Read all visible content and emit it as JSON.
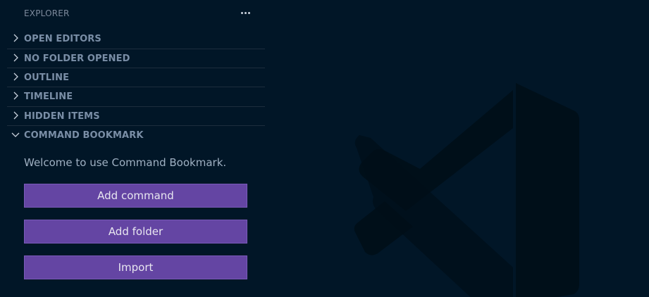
{
  "explorer": {
    "title": "EXPLORER",
    "more_actions_icon": "ellipsis-icon"
  },
  "sections": [
    {
      "label": "OPEN EDITORS",
      "expanded": false
    },
    {
      "label": "NO FOLDER OPENED",
      "expanded": false
    },
    {
      "label": "OUTLINE",
      "expanded": false
    },
    {
      "label": "TIMELINE",
      "expanded": false
    },
    {
      "label": "HIDDEN ITEMS",
      "expanded": false
    },
    {
      "label": "COMMAND BOOKMARK",
      "expanded": true
    }
  ],
  "command_bookmark": {
    "welcome_text": "Welcome to use Command Bookmark.",
    "buttons": {
      "add_command": "Add command",
      "add_folder": "Add folder",
      "import": "Import"
    }
  },
  "colors": {
    "background": "#011627",
    "button_bg": "#6445a3",
    "section_label": "#7a8ea6",
    "welcome_text": "#9fb0c2"
  }
}
